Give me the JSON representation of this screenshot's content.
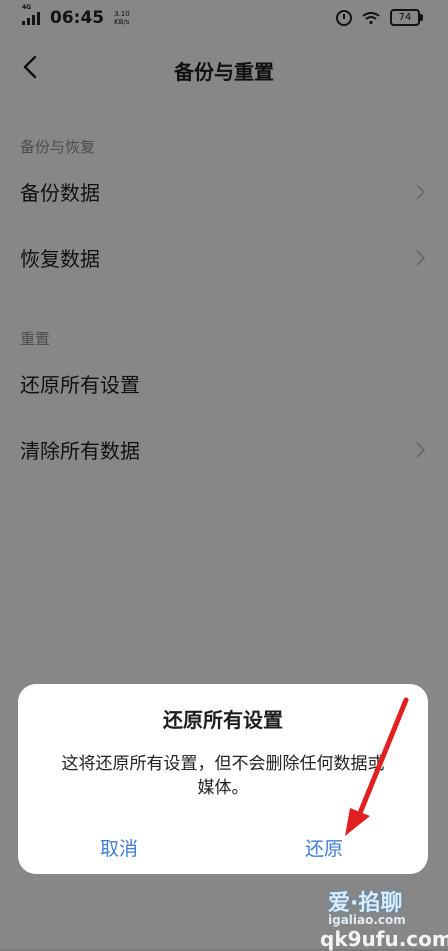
{
  "status_bar": {
    "network": "4G",
    "time": "06:45",
    "speed_value": "3.10",
    "speed_unit": "KB/s",
    "battery": "74"
  },
  "header": {
    "title": "备份与重置"
  },
  "sections": [
    {
      "label": "备份与恢复"
    },
    {
      "label": "重置"
    }
  ],
  "rows": {
    "backup": "备份数据",
    "restore_data": "恢复数据",
    "reset_all": "还原所有设置",
    "clear_all": "清除所有数据"
  },
  "dialog": {
    "title": "还原所有设置",
    "message": "这将还原所有设置，但不会删除任何数据或媒体。",
    "cancel": "取消",
    "confirm": "还原"
  },
  "watermark": {
    "line1": "爱·掐聊",
    "line2": "igaliao.com",
    "line3": "qk9ufu.com"
  },
  "colors": {
    "accent": "#3f7fd6",
    "annotation_arrow": "#e02020"
  }
}
